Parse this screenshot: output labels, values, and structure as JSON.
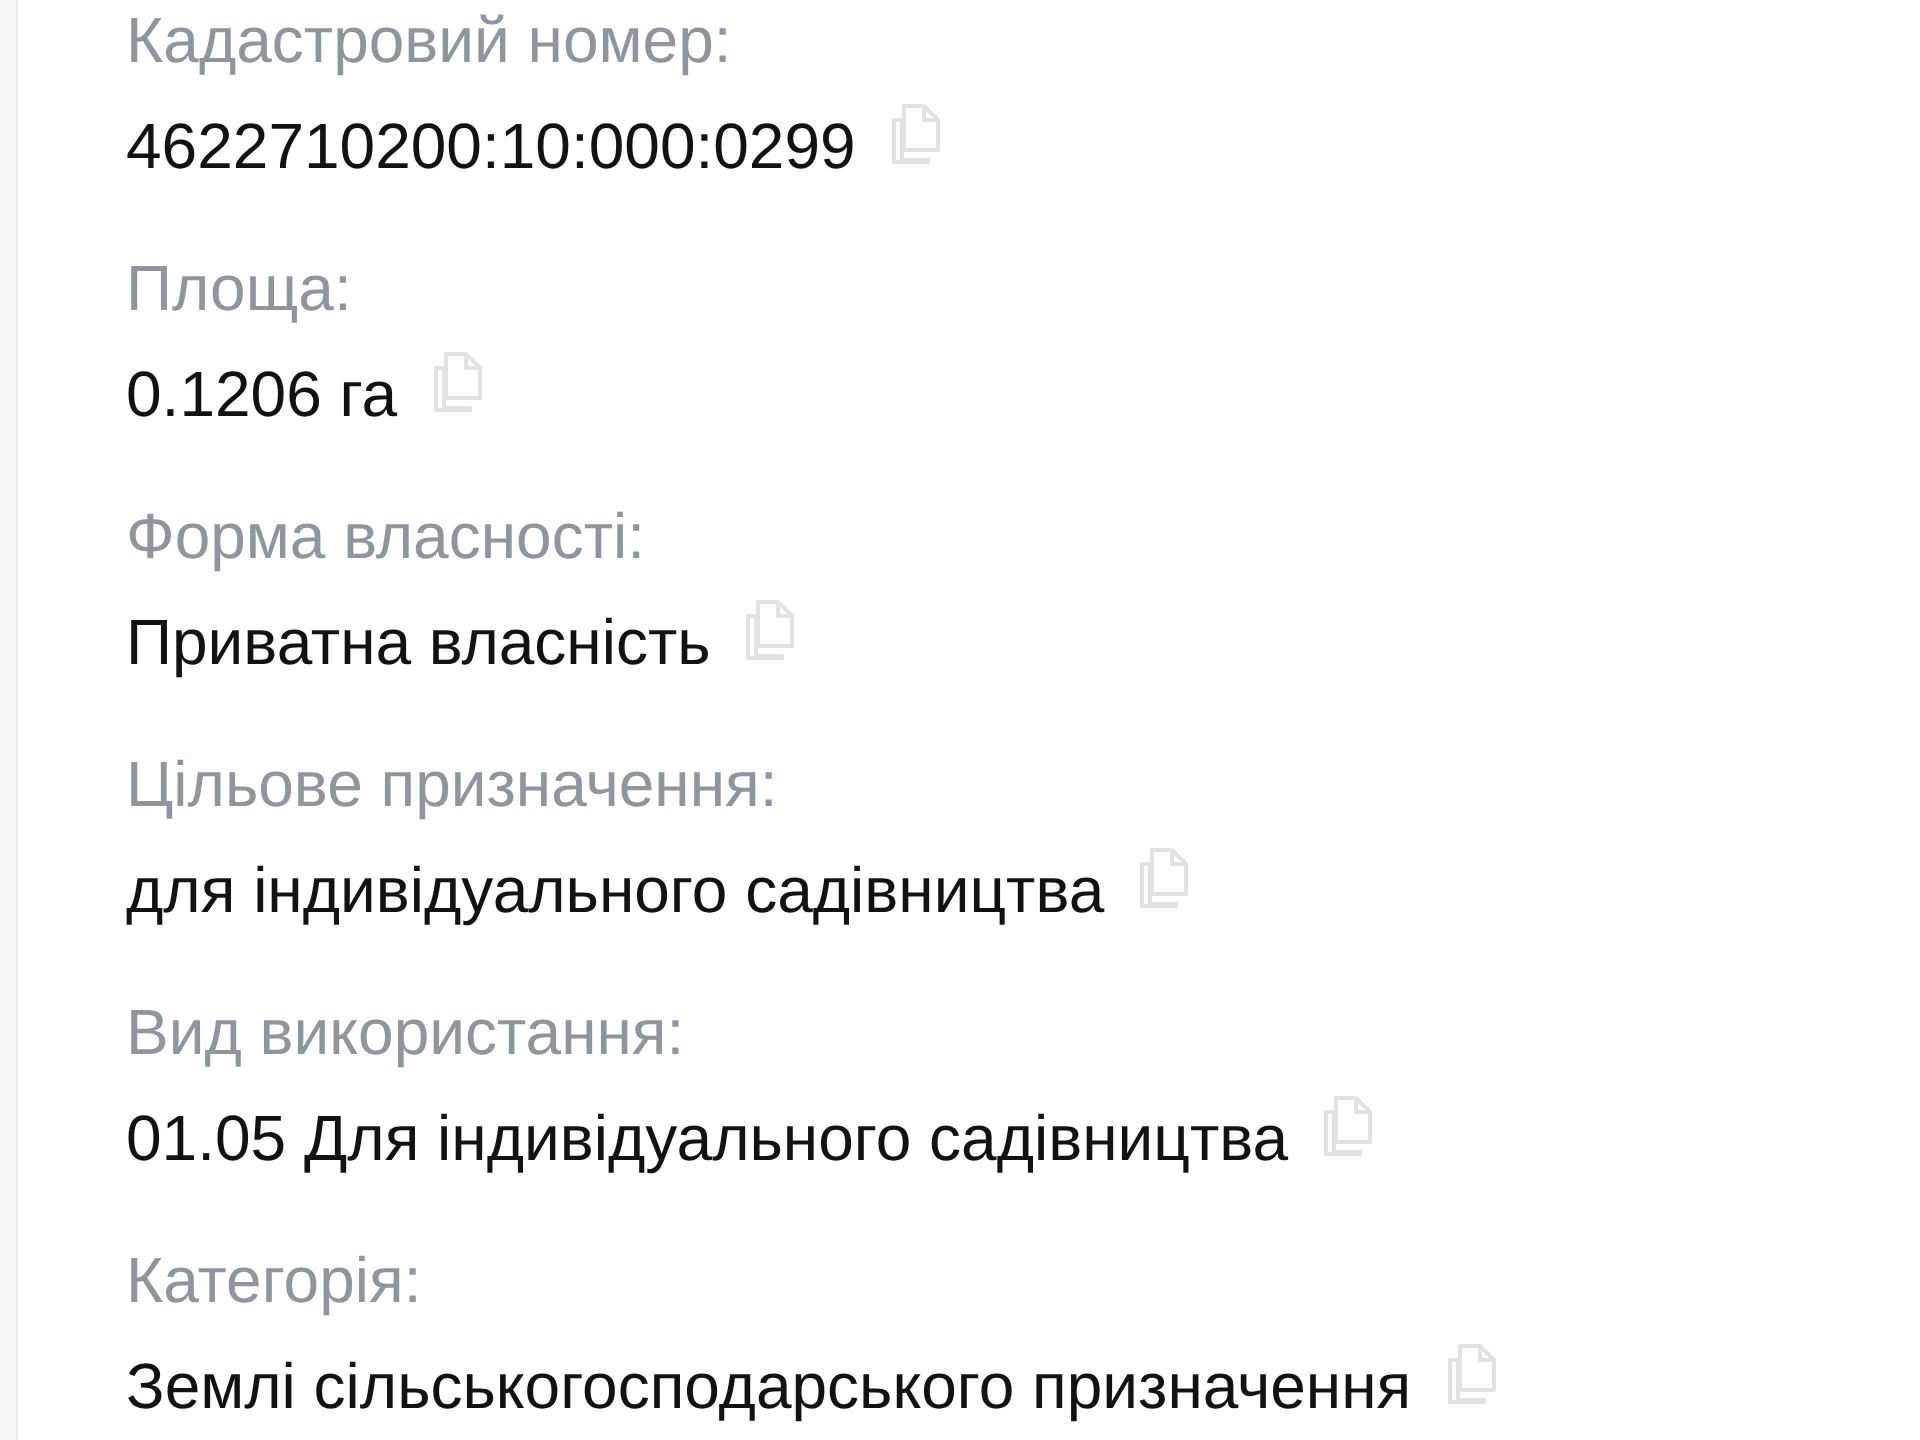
{
  "fields": [
    {
      "label": "Кадастровий номер:",
      "value": "4622710200:10:000:0299"
    },
    {
      "label": "Площа:",
      "value": "0.1206 га"
    },
    {
      "label": "Форма власності:",
      "value": "Приватна власність"
    },
    {
      "label": "Цільове призначення:",
      "value": "для індивідуального садівництва"
    },
    {
      "label": "Вид використання:",
      "value": "01.05 Для індивідуального садівництва"
    },
    {
      "label": "Категорія:",
      "value": "Землі сільськогосподарського призначення"
    }
  ]
}
